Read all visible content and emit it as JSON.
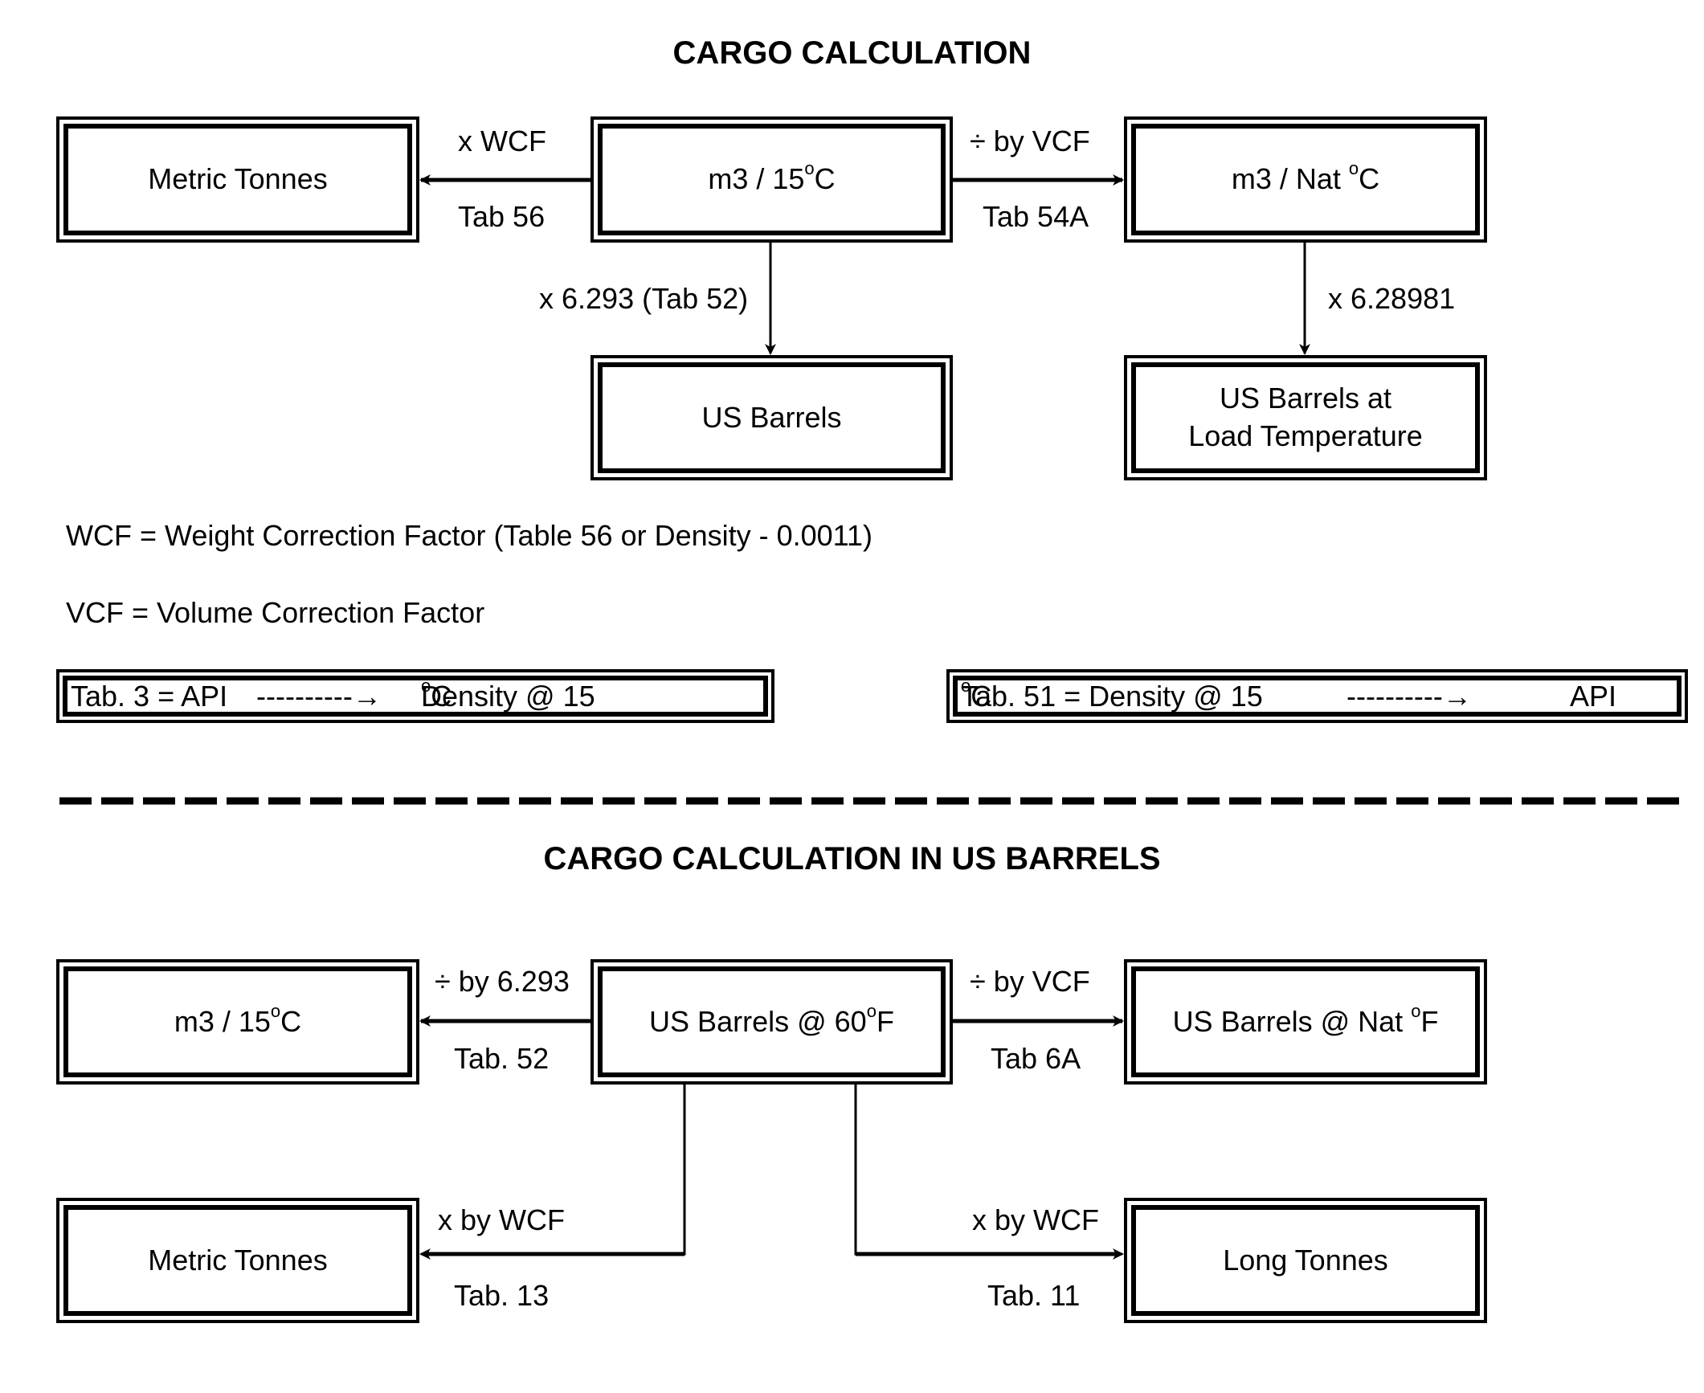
{
  "diagram1": {
    "title": "CARGO CALCULATION",
    "nodes": {
      "metric_tonnes": "Metric Tonnes",
      "m3_15c_pre": "m3 / 15",
      "m3_15c_sup": "o",
      "m3_15c_post": "C",
      "m3_nat_pre": "m3 / Nat ",
      "m3_nat_sup": "o",
      "m3_nat_post": "C",
      "us_barrels": "US Barrels",
      "us_barrels_load_temp": "US Barrels at Load Temperature"
    },
    "edges": {
      "to_metric_top": "x WCF",
      "to_metric_bottom": "Tab 56",
      "to_nat_top": "÷ by VCF",
      "to_nat_bottom": "Tab 54A",
      "to_barrels": "x 6.293 (Tab 52)",
      "to_load_temp": "x 6.28981"
    },
    "notes": {
      "wcf": "WCF = Weight Correction Factor (Table 56 or Density - 0.0011)",
      "vcf": "VCF = Volume Correction Factor"
    },
    "table_boxes": {
      "tab3_left": "Tab. 3 = API",
      "tab3_arrow": "----------→",
      "tab3_right_pre": "Density @ 15",
      "tab3_right_sup": "o",
      "tab3_right_post": "C",
      "tab51_left_pre": "Tab. 51 = Density @ 15",
      "tab51_left_sup": "o",
      "tab51_left_post": "C",
      "tab51_arrow": "----------→",
      "tab51_right": "API"
    }
  },
  "diagram2": {
    "title": "CARGO CALCULATION IN US BARRELS",
    "nodes": {
      "m3_15c_pre": "m3 / 15",
      "m3_15c_sup": "o",
      "m3_15c_post": "C",
      "barrels_60f_pre": "US Barrels @ 60",
      "barrels_60f_sup": "o",
      "barrels_60f_post": "F",
      "barrels_nat_pre": "US Barrels @ Nat ",
      "barrels_nat_sup": "o",
      "barrels_nat_post": "F",
      "metric_tonnes": "Metric Tonnes",
      "long_tonnes": "Long Tonnes"
    },
    "edges": {
      "to_m3_top": "÷ by 6.293",
      "to_m3_bottom": "Tab. 52",
      "to_nat_top": "÷  by VCF",
      "to_nat_bottom": "Tab 6A",
      "to_metric_top": "x by WCF",
      "to_metric_bottom": "Tab. 13",
      "to_long_top": "x by WCF",
      "to_long_bottom": "Tab. 11"
    }
  }
}
